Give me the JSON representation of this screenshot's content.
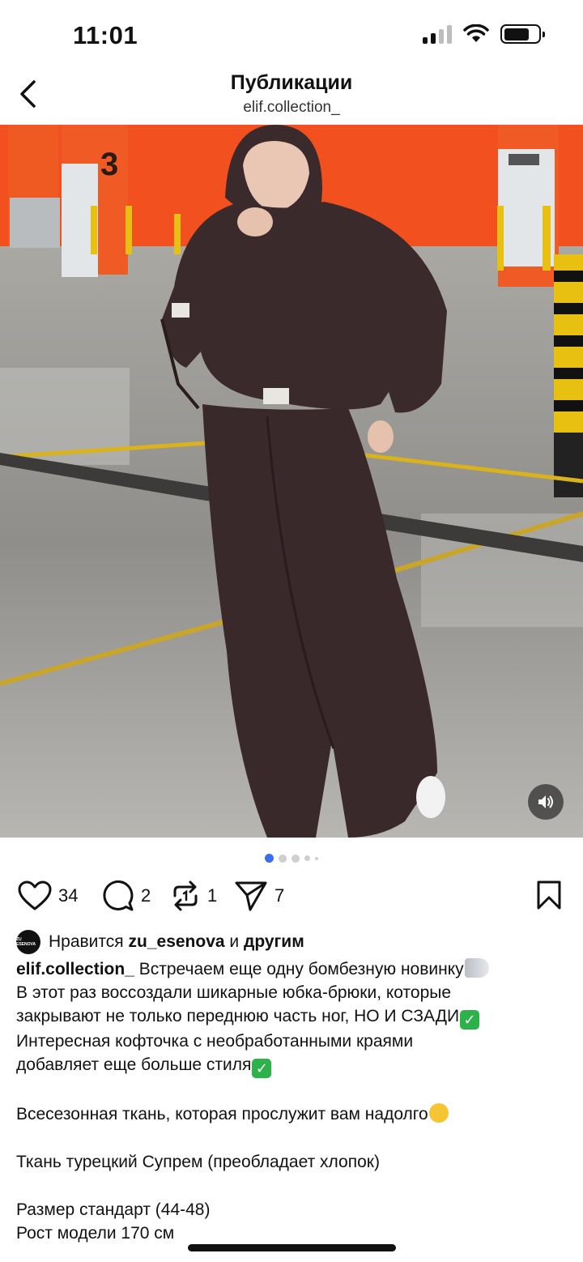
{
  "status_bar": {
    "time": "11:01"
  },
  "header": {
    "title": "Публикации",
    "subtitle": "elif.collection_"
  },
  "post": {
    "image_description_icon": "photo",
    "carousel": {
      "total": 5,
      "active": 1
    },
    "actions": {
      "likes": "34",
      "comments": "2",
      "reposts": "1",
      "shares": "7"
    },
    "liked_by": {
      "prefix": "Нравится",
      "user": "zu_esenova",
      "joiner": "и",
      "others": "другим",
      "avatar_text": "ZU ESENOVA"
    },
    "caption": {
      "user": "elif.collection_",
      "line1": "Встречаем еще одну бомбезную новинку",
      "line2": "В этот раз воссоздали шикарные юбка-брюки, которые",
      "line3": "закрывают не только переднюю часть ног, НО И СЗАДИ",
      "line4": "Интересная кофточка с необработанными краями",
      "line5": "добавляет  еще больше стиля",
      "line6": "Всесезонная ткань, которая прослужит вам надолго",
      "line7": "Ткань турецкий Супрем (преобладает хлопок)",
      "line8": "Размер стандарт (44-48)",
      "line9": "Рост модели 170 см"
    }
  },
  "colors": {
    "accent_dot": "#3a6df0",
    "wall_orange": "#f2501f",
    "outfit": "#3b2a2c"
  }
}
